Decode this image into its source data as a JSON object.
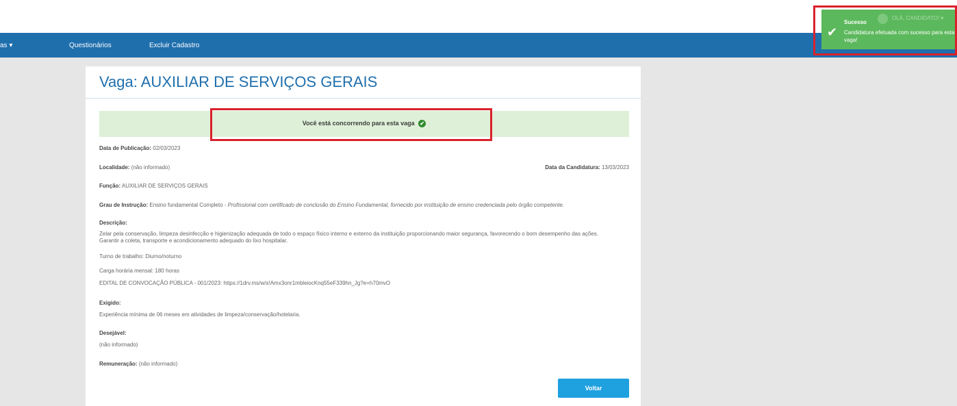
{
  "nav": {
    "items": [
      "as ▾",
      "Questionários",
      "Excluir Cadastro"
    ]
  },
  "toast": {
    "title": "Sucesso",
    "message": "Candidatura efetuada com sucesso para esta vaga!",
    "user": "OLÁ, CANDIDATO! ▾"
  },
  "vaga": {
    "title": "Vaga: AUXILIAR DE SERVIÇOS GERAIS",
    "status": "Você está concorrendo para esta vaga",
    "pub_label": "Data de Publicação:",
    "pub_value": "02/03/2023",
    "loc_label": "Localidade:",
    "loc_value": "(não informado)",
    "cand_label": "Data da Candidatura:",
    "cand_value": "13/03/2023",
    "func_label": "Função:",
    "func_value": "AUXILIAR DE SERVIÇOS GERAIS",
    "grau_label": "Grau de Instrução:",
    "grau_value": "Ensino fundamental Completo -",
    "grau_desc": "Profissional com certificado de conclusão do Ensino Fundamental, fornecido por instituição de ensino credenciada pelo órgão competente.",
    "desc_label": "Descrição:",
    "desc_text": "Zelar pela conservação, limpeza desinfecção e higienização adequada de todo o espaço físico interno e externo da instituição proporcionando maior segurança, favorecendo o bom desempenho das ações. Garantir a coleta, transporte e acondicionamento adequado do lixo hospitalar.",
    "turno": "Turno de trabalho: Diurno/noturno",
    "carga": "Carga horária mensal: 180 horas",
    "edital": "EDITAL DE CONVOCAÇÃO PÚBLICA - 001/2023: https://1drv.ms/w/s!Amx3onr1mbleiocKnq55eF339hn_Jg?e=h70mvO",
    "exig_label": "Exigido:",
    "exig_text": "Experiência mínima de 06 meses em atividades de limpeza/conservação/hotelaria.",
    "des_label": "Desejável:",
    "des_text": "(não informado)",
    "rem_label": "Remuneração:",
    "rem_value": "(não informado)",
    "back_button": "Voltar"
  },
  "colors": {
    "navbar": "#1f6fad",
    "toast": "#5cb85c",
    "highlight": "#d9212b",
    "button": "#1fa1e0"
  }
}
